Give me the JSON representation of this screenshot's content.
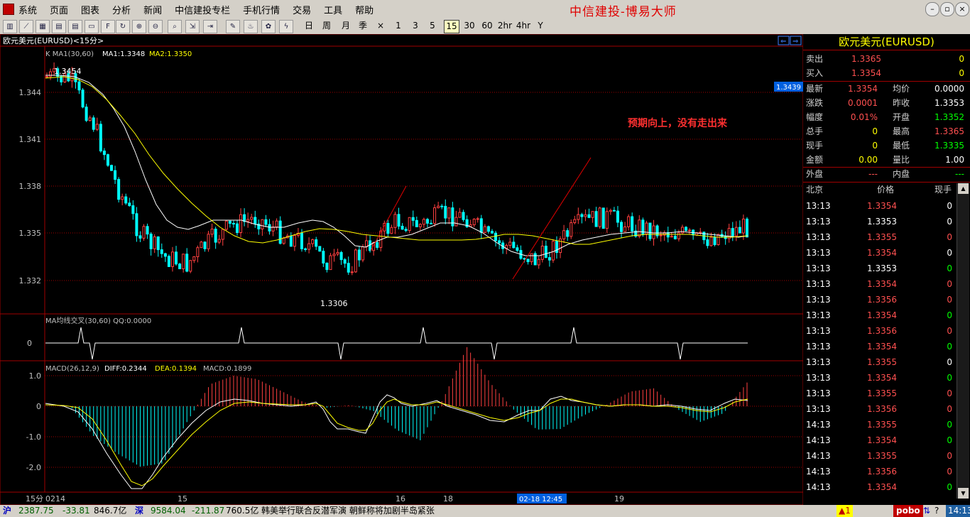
{
  "menu": {
    "items": [
      "系统",
      "页面",
      "图表",
      "分析",
      "新闻",
      "中信建投专栏",
      "手机行情",
      "交易",
      "工具",
      "帮助"
    ],
    "brand": "中信建投-博易大师"
  },
  "toolbar": {
    "periods": [
      "日",
      "周",
      "月",
      "季",
      "×",
      "1",
      "3",
      "5",
      "15",
      "30",
      "60",
      "2hr",
      "4hr",
      "Y"
    ],
    "selected_period": "15"
  },
  "chart": {
    "tab_title": "欧元美元(EURUSD)<15分>",
    "ma_legend": {
      "prefix": "K  MA1(30,60)",
      "ma1": "MA1:1.3348",
      "ma2": "MA2:1.3350"
    },
    "y_labels": [
      "1.344",
      "1.341",
      "1.338",
      "1.335",
      "1.332"
    ],
    "current_price_tag": "1.3439",
    "high_label": "1.3454",
    "low_label": "1.3306",
    "annotation": "预期向上，没有走出来",
    "cross_panel": {
      "legend": "MA均线交叉(30,60)  QQ:0.0000",
      "zero_label": "0"
    },
    "macd_panel": {
      "legend_prefix": "MACD(26,12,9)",
      "diff": "DIFF:0.2344",
      "dea": "DEA:0.1394",
      "macd": "MACD:0.1899",
      "y_labels": [
        "1.0",
        "0",
        "-1.0",
        "-2.0"
      ]
    },
    "x_axis": {
      "period_label": "15分",
      "labels": [
        "0214",
        "15",
        "16",
        "18",
        "02-18 12:45",
        "19"
      ]
    }
  },
  "chart_data": {
    "type": "line",
    "title": "欧元美元(EURUSD)<15分>",
    "xlabel": "",
    "ylabel": "",
    "price_range": [
      1.3306,
      1.3454
    ],
    "x_ticks": [
      "0214",
      "15",
      "16",
      "18",
      "02-18 12:45",
      "19"
    ],
    "ma_close_approx": [
      1.345,
      1.3448,
      1.342,
      1.338,
      1.335,
      1.3335,
      1.333,
      1.3345,
      1.3355,
      1.336,
      1.335,
      1.3345,
      1.3332,
      1.333,
      1.3345,
      1.3358,
      1.3355,
      1.3362,
      1.336,
      1.3345,
      1.334,
      1.3332,
      1.3345,
      1.3358,
      1.336,
      1.3355,
      1.3352,
      1.335,
      1.3345,
      1.335,
      1.3354
    ],
    "macd_diff_approx": [
      0.0,
      0.0,
      -0.5,
      -1.2,
      -2.0,
      -2.6,
      -2.4,
      -1.6,
      -0.8,
      -0.2,
      0.1,
      0.15,
      0.1,
      0.1,
      0.0,
      -0.4,
      -0.9,
      -0.6,
      0.5,
      0.8,
      0.6,
      0.1,
      -0.3,
      -0.4,
      -0.3,
      0.0,
      0.3,
      0.2,
      -0.1,
      -0.2,
      0.2344
    ]
  },
  "quote": {
    "title": "欧元美元(EURUSD)",
    "sell_label": "卖出",
    "sell_price": "1.3365",
    "sell_vol": "0",
    "buy_label": "买入",
    "buy_price": "1.3354",
    "buy_vol": "0",
    "rows": [
      {
        "l1": "最新",
        "v1": "1.3354",
        "c1": "red",
        "l2": "均价",
        "v2": "0.0000",
        "c2": "white"
      },
      {
        "l1": "涨跌",
        "v1": "0.0001",
        "c1": "red",
        "l2": "昨收",
        "v2": "1.3353",
        "c2": "white"
      },
      {
        "l1": "幅度",
        "v1": "0.01%",
        "c1": "red",
        "l2": "开盘",
        "v2": "1.3352",
        "c2": "green"
      },
      {
        "l1": "总手",
        "v1": "0",
        "c1": "yellow",
        "l2": "最高",
        "v2": "1.3365",
        "c2": "red"
      },
      {
        "l1": "现手",
        "v1": "0",
        "c1": "yellow",
        "l2": "最低",
        "v2": "1.3335",
        "c2": "green"
      },
      {
        "l1": "金额",
        "v1": "0.00",
        "c1": "yellow",
        "l2": "量比",
        "v2": "1.00",
        "c2": "white"
      },
      {
        "l1": "外盘",
        "v1": "---",
        "c1": "red",
        "l2": "内盘",
        "v2": "---",
        "c2": "green"
      }
    ],
    "ticks_header": {
      "time": "北京",
      "price": "价格",
      "vol": "现手"
    },
    "ticks": [
      {
        "t": "13:13",
        "p": "1.3354",
        "pc": "red",
        "v": "0",
        "vc": "white"
      },
      {
        "t": "13:13",
        "p": "1.3353",
        "pc": "white",
        "v": "0",
        "vc": "white"
      },
      {
        "t": "13:13",
        "p": "1.3355",
        "pc": "red",
        "v": "0",
        "vc": "red"
      },
      {
        "t": "13:13",
        "p": "1.3354",
        "pc": "red",
        "v": "0",
        "vc": "white"
      },
      {
        "t": "13:13",
        "p": "1.3353",
        "pc": "white",
        "v": "0",
        "vc": "green"
      },
      {
        "t": "13:13",
        "p": "1.3354",
        "pc": "red",
        "v": "0",
        "vc": "red"
      },
      {
        "t": "13:13",
        "p": "1.3356",
        "pc": "red",
        "v": "0",
        "vc": "red"
      },
      {
        "t": "13:13",
        "p": "1.3354",
        "pc": "red",
        "v": "0",
        "vc": "green"
      },
      {
        "t": "13:13",
        "p": "1.3356",
        "pc": "red",
        "v": "0",
        "vc": "red"
      },
      {
        "t": "13:13",
        "p": "1.3354",
        "pc": "red",
        "v": "0",
        "vc": "green"
      },
      {
        "t": "13:13",
        "p": "1.3355",
        "pc": "red",
        "v": "0",
        "vc": "white"
      },
      {
        "t": "13:13",
        "p": "1.3354",
        "pc": "red",
        "v": "0",
        "vc": "green"
      },
      {
        "t": "13:13",
        "p": "1.3355",
        "pc": "red",
        "v": "0",
        "vc": "red"
      },
      {
        "t": "13:13",
        "p": "1.3356",
        "pc": "red",
        "v": "0",
        "vc": "red"
      },
      {
        "t": "14:13",
        "p": "1.3355",
        "pc": "red",
        "v": "0",
        "vc": "green"
      },
      {
        "t": "14:13",
        "p": "1.3354",
        "pc": "red",
        "v": "0",
        "vc": "green"
      },
      {
        "t": "14:13",
        "p": "1.3355",
        "pc": "red",
        "v": "0",
        "vc": "red"
      },
      {
        "t": "14:13",
        "p": "1.3356",
        "pc": "red",
        "v": "0",
        "vc": "red"
      },
      {
        "t": "14:13",
        "p": "1.3354",
        "pc": "red",
        "v": "0",
        "vc": "green"
      }
    ]
  },
  "status": {
    "sh_label": "沪",
    "sh_index": "2387.75",
    "sh_change": "-33.81",
    "sh_amount": "846.7亿",
    "sz_label": "深",
    "sz_index": "9584.04",
    "sz_change": "-211.87",
    "sz_amount": "760.5亿",
    "news": "韩美举行联合反潜军演 朝鲜称将加剧半岛紧张",
    "alert": "▲1",
    "logo": "pobo",
    "clock": "14:13"
  }
}
